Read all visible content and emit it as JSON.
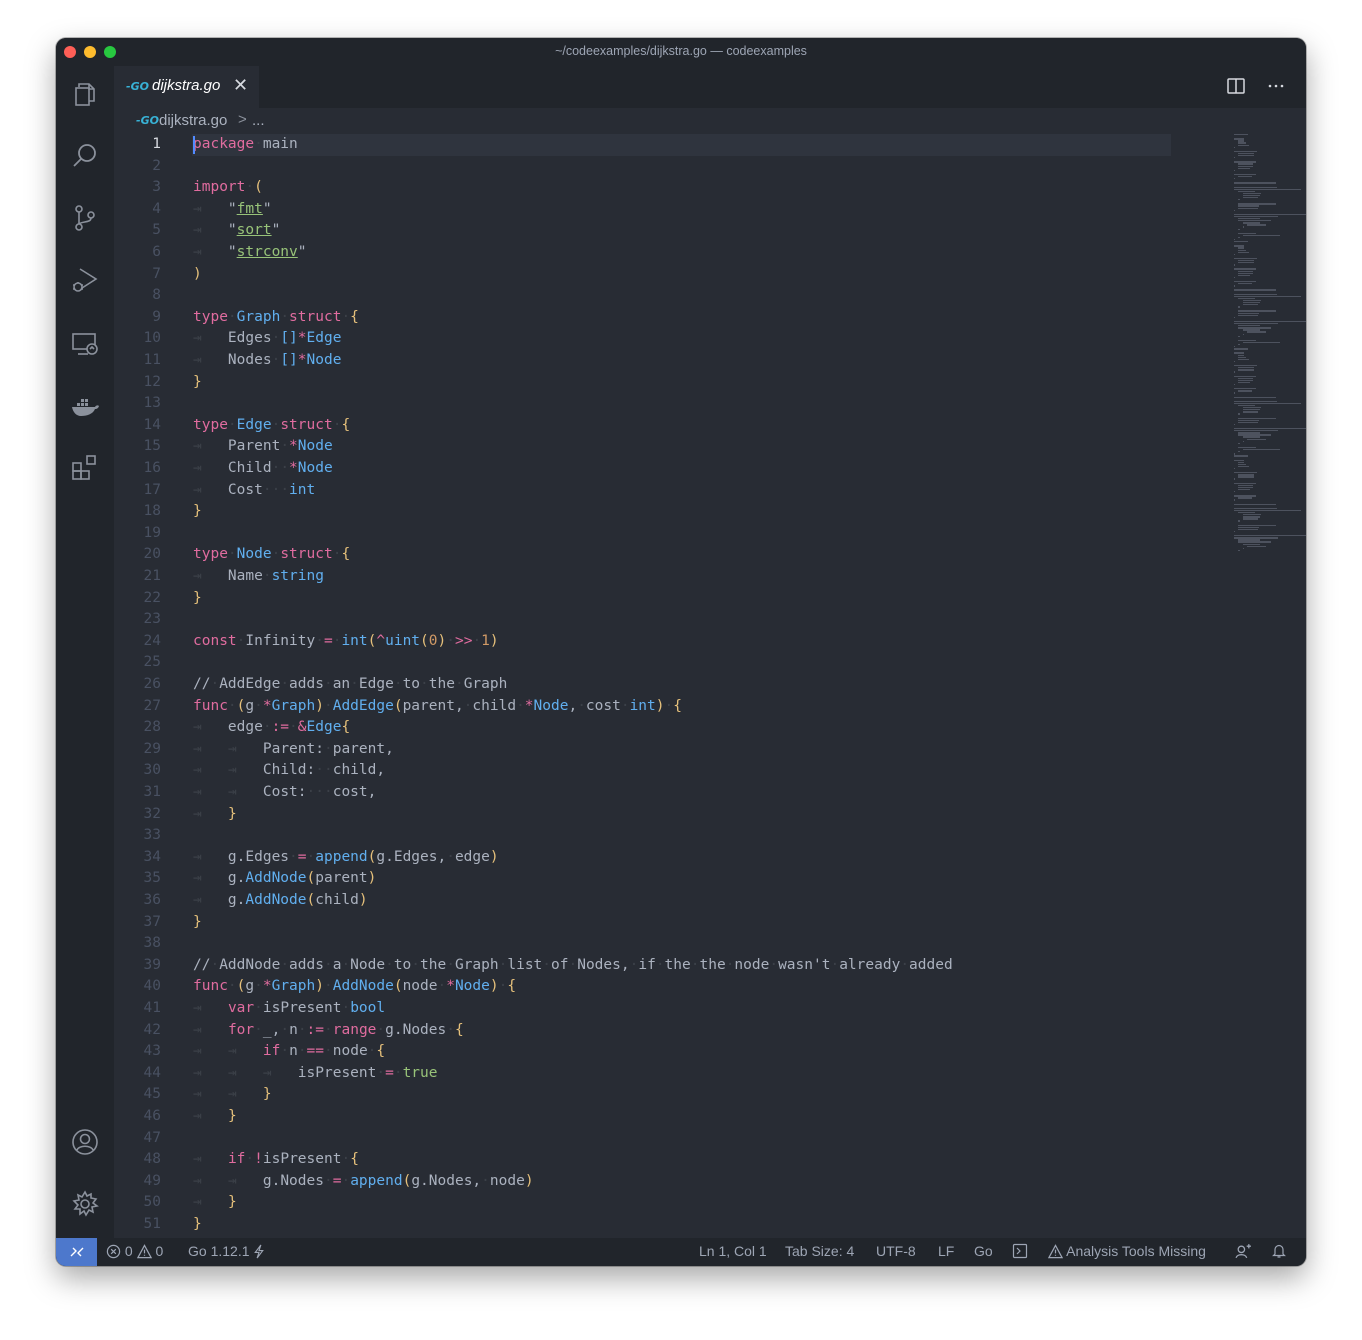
{
  "window": {
    "title": "~/codeexamples/dijkstra.go — codeexamples"
  },
  "activity_bar": [
    {
      "name": "explorer-icon"
    },
    {
      "name": "search-icon"
    },
    {
      "name": "source-control-icon"
    },
    {
      "name": "run-debug-icon"
    },
    {
      "name": "remote-explorer-icon"
    },
    {
      "name": "docker-icon"
    },
    {
      "name": "extensions-icon"
    },
    {
      "name": "accounts-icon"
    },
    {
      "name": "manage-gear-icon"
    }
  ],
  "tab": {
    "icon_text": "-GO",
    "label": "dijkstra.go",
    "close": "✕"
  },
  "breadcrumb": {
    "icon_text": "-GO",
    "file": "dijkstra.go",
    "separator": ">",
    "more": "..."
  },
  "editor": {
    "active_line": 1,
    "lines": [
      "package main",
      "",
      "import (",
      "    \"fmt\"",
      "    \"sort\"",
      "    \"strconv\"",
      ")",
      "",
      "type Graph struct {",
      "    Edges []*Edge",
      "    Nodes []*Node",
      "}",
      "",
      "type Edge struct {",
      "    Parent *Node",
      "    Child  *Node",
      "    Cost   int",
      "}",
      "",
      "type Node struct {",
      "    Name string",
      "}",
      "",
      "const Infinity = int(^uint(0) >> 1)",
      "",
      "// AddEdge adds an Edge to the Graph",
      "func (g *Graph) AddEdge(parent, child *Node, cost int) {",
      "    edge := &Edge{",
      "        Parent: parent,",
      "        Child:  child,",
      "        Cost:   cost,",
      "    }",
      "",
      "    g.Edges = append(g.Edges, edge)",
      "    g.AddNode(parent)",
      "    g.AddNode(child)",
      "}",
      "",
      "// AddNode adds a Node to the Graph list of Nodes, if the the node wasn't already added",
      "func (g *Graph) AddNode(node *Node) {",
      "    var isPresent bool",
      "    for _, n := range g.Nodes {",
      "        if n == node {",
      "            isPresent = true",
      "        }",
      "    }",
      "",
      "    if !isPresent {",
      "        g.Nodes = append(g.Nodes, node)",
      "    }",
      "}"
    ]
  },
  "status_bar": {
    "errors": "0",
    "warnings": "0",
    "go_version": "Go 1.12.1",
    "cursor_position": "Ln 1, Col 1",
    "tab_size": "Tab Size: 4",
    "encoding": "UTF-8",
    "eol": "LF",
    "language": "Go",
    "analysis": "Analysis Tools Missing"
  },
  "colors": {
    "editor_bg": "#282c34",
    "chrome_bg": "#21252b",
    "keyword": "#e06c9f",
    "type": "#61afef",
    "string": "#98c379",
    "number": "#d19a66",
    "remote_accent": "#4d78cc"
  }
}
